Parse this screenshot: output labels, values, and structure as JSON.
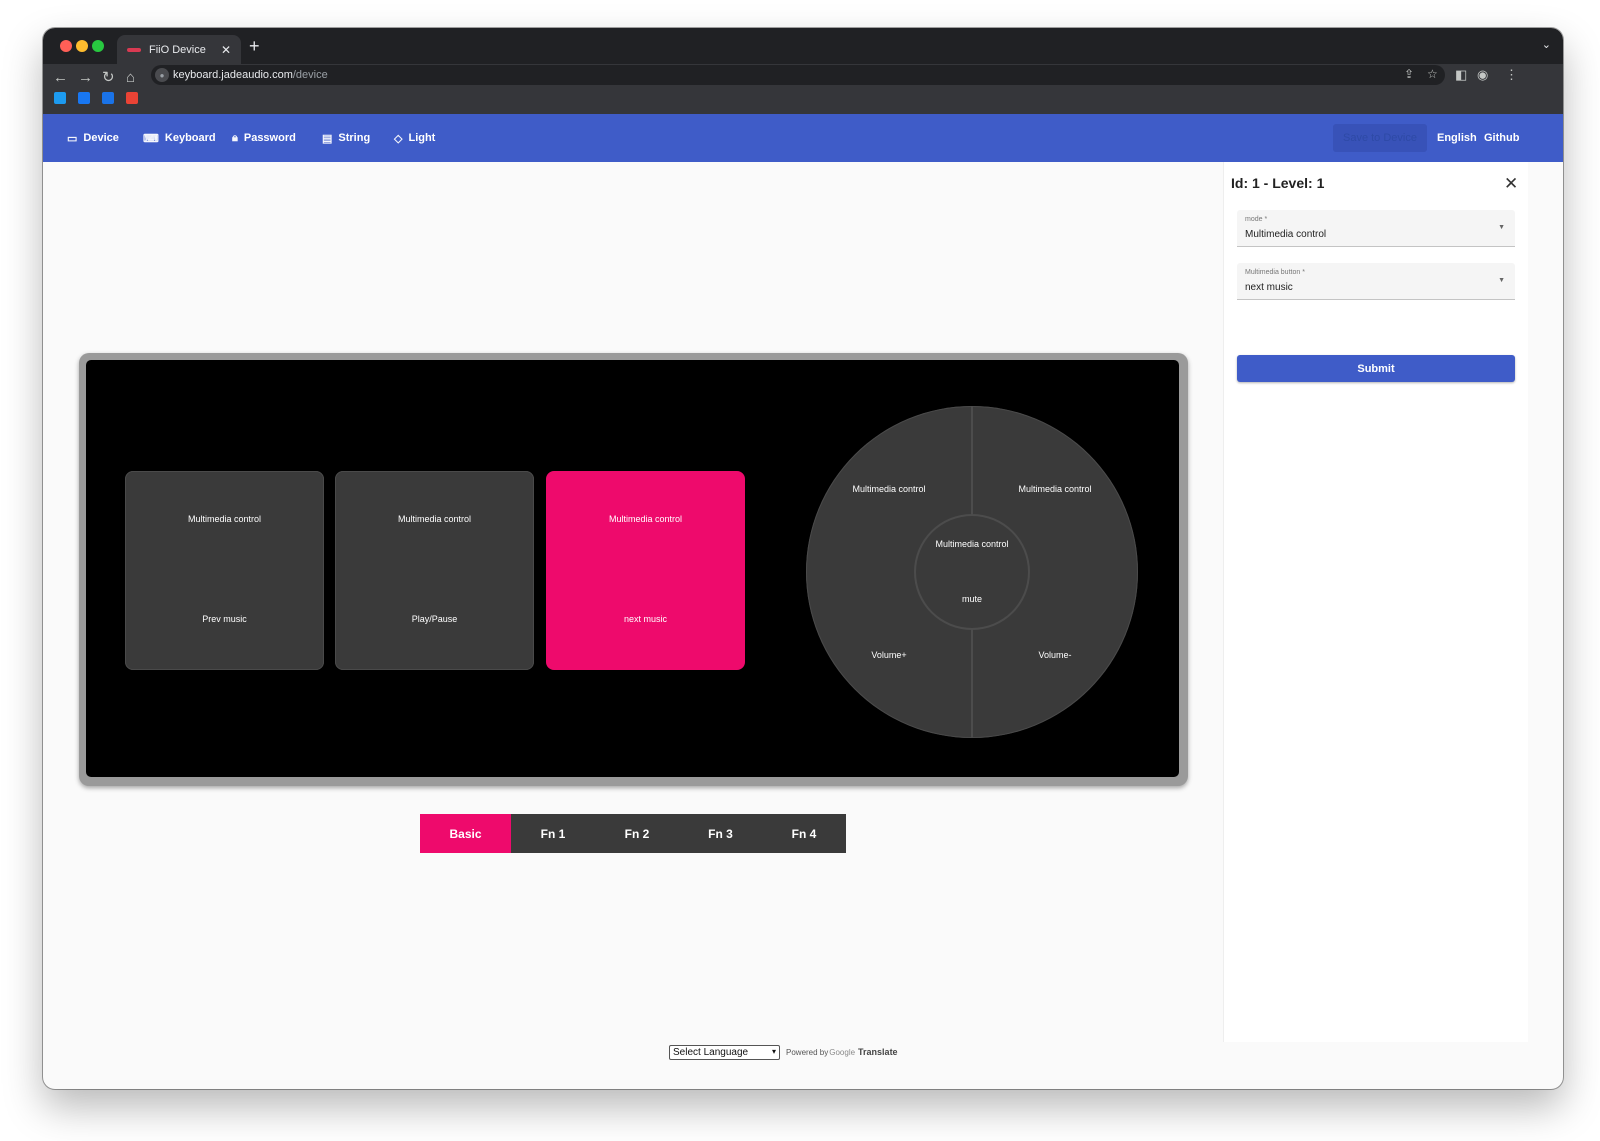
{
  "browser": {
    "tab_title": "FiiO Device",
    "tab_close": "✕",
    "new_tab": "+",
    "url_host": "keyboard.jadeaudio.com",
    "url_path": "/device"
  },
  "nav": {
    "items": [
      {
        "label": "Device",
        "icon": "device-icon"
      },
      {
        "label": "Keyboard",
        "icon": "keyboard-icon"
      },
      {
        "label": "Password",
        "icon": "lock-icon"
      },
      {
        "label": "String",
        "icon": "message-icon"
      },
      {
        "label": "Light",
        "icon": "light-icon"
      }
    ],
    "save_label": "Save to Device",
    "language_label": "English",
    "github_label": "Github",
    "accent_color": "#3f5cc8"
  },
  "keyboard": {
    "keys": [
      {
        "mode": "Multimedia control",
        "function": "Prev music",
        "selected": false
      },
      {
        "mode": "Multimedia control",
        "function": "Play/Pause",
        "selected": false
      },
      {
        "mode": "Multimedia control",
        "function": "next music",
        "selected": true
      }
    ],
    "knob": {
      "top_left": "Multimedia control",
      "top_right": "Multimedia control",
      "center_mode": "Multimedia control",
      "center_function": "mute",
      "bottom_left": "Volume+",
      "bottom_right": "Volume-"
    },
    "selected_color": "#ee0a6c"
  },
  "layers": {
    "tabs": [
      "Basic",
      "Fn 1",
      "Fn 2",
      "Fn 3",
      "Fn 4"
    ],
    "active": "Basic"
  },
  "panel": {
    "title": "Id:  1 - Level: 1",
    "close_icon": "close-icon",
    "mode_label": "mode *",
    "mode_value": "Multimedia control",
    "button_label": "Multimedia button *",
    "button_value": "next music",
    "submit_label": "Submit"
  },
  "footer": {
    "select_language": "Select Language",
    "powered_by": "Powered by",
    "google": "Google",
    "translate": "Translate"
  }
}
